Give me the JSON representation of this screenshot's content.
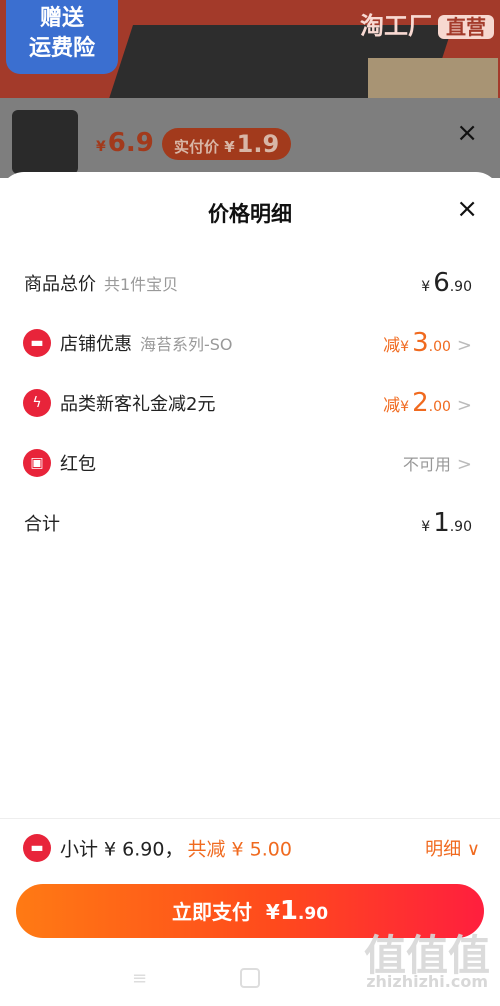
{
  "background": {
    "badge_gift": "赠送\n运费险",
    "badge_factory": "淘工厂",
    "badge_factory_tag": "直营",
    "product_price_symbol": "¥",
    "product_price": "6.9",
    "actual_label": "实付价 ¥",
    "actual_price": "1.9",
    "close_icon": "×"
  },
  "sheet": {
    "title": "价格明细",
    "close_icon": "×"
  },
  "rows": {
    "total": {
      "label": "商品总价",
      "sub": "共1件宝贝",
      "yen": "¥",
      "int": "6",
      "dec": ".90"
    },
    "shop": {
      "label": "店铺优惠",
      "sub": "海苔系列-SO",
      "prefix": "减",
      "yen": "¥",
      "int": "3",
      "dec": ".00",
      "chev": ">"
    },
    "category": {
      "label": "品类新客礼金减2元",
      "prefix": "减",
      "yen": "¥",
      "int": "2",
      "dec": ".00",
      "chev": ">"
    },
    "redpacket": {
      "label": "红包",
      "status": "不可用",
      "chev": ">"
    },
    "sum": {
      "label": "合计",
      "yen": "¥",
      "int": "1",
      "dec": ".90"
    }
  },
  "footer": {
    "subtotal": "小计 ¥ 6.90，",
    "reduction": "共减 ¥ 5.00",
    "detail": "明细",
    "detail_chevron": "∨",
    "pay_label": "立即支付",
    "pay_yen": "¥",
    "pay_int": "1",
    "pay_dec": ".90"
  },
  "nav": {
    "menu_icon": "≡"
  },
  "watermark": {
    "main": "值值值",
    "sub": "zhizhizhi.com"
  },
  "colors": {
    "accent": "#f06a1f",
    "icon_red": "#e8243a",
    "pay_gradient_start": "#ff7a14",
    "pay_gradient_end": "#ff1f3e"
  }
}
